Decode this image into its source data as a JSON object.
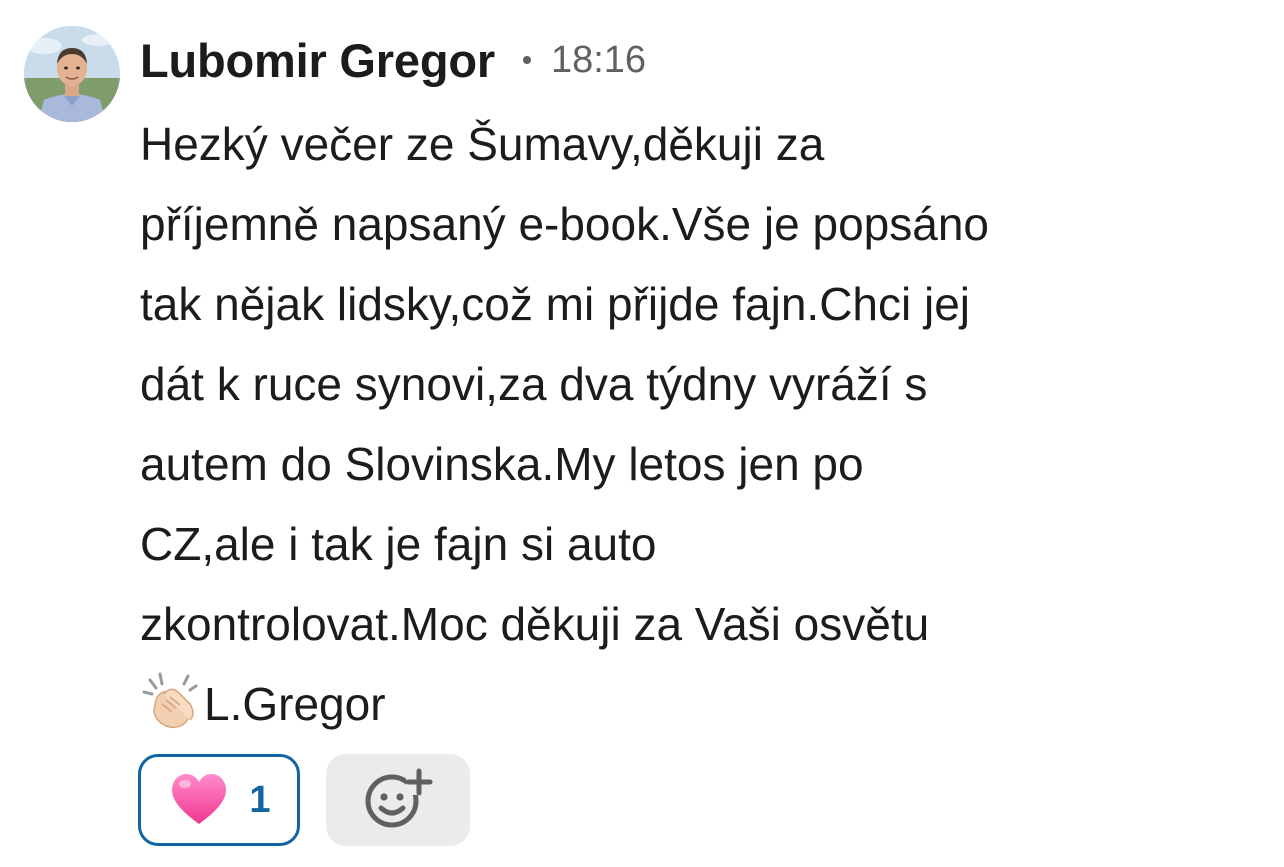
{
  "message": {
    "sender_name": "Lubomir Gregor",
    "timestamp": "18:16",
    "lines": [
      "Hezký večer ze Šumavy,děkuji za",
      "příjemně napsaný e-book.Vše je popsáno",
      "tak nějak lidsky,což mi přijde fajn.Chci jej",
      "dát k ruce synovi,za dva týdny vyráží s",
      "autem do Slovinska.My letos jen po",
      "CZ,ale i tak je fajn si auto",
      "zkontrolovat.Moc děkuji za Vaši osvětu"
    ],
    "last_line_emoji": "clapping-hands-icon",
    "signature": "L.Gregor"
  },
  "reactions": [
    {
      "emoji": "pink-heart-icon",
      "count": "1",
      "selected": true
    }
  ],
  "add_reaction": {
    "icon": "add-reaction-smiley-icon"
  },
  "colors": {
    "text": "#1d1c1d",
    "secondary": "#616061",
    "accent": "#1264a3",
    "add_reaction_bg": "#ecebea",
    "heart": "#ff4fa8"
  }
}
